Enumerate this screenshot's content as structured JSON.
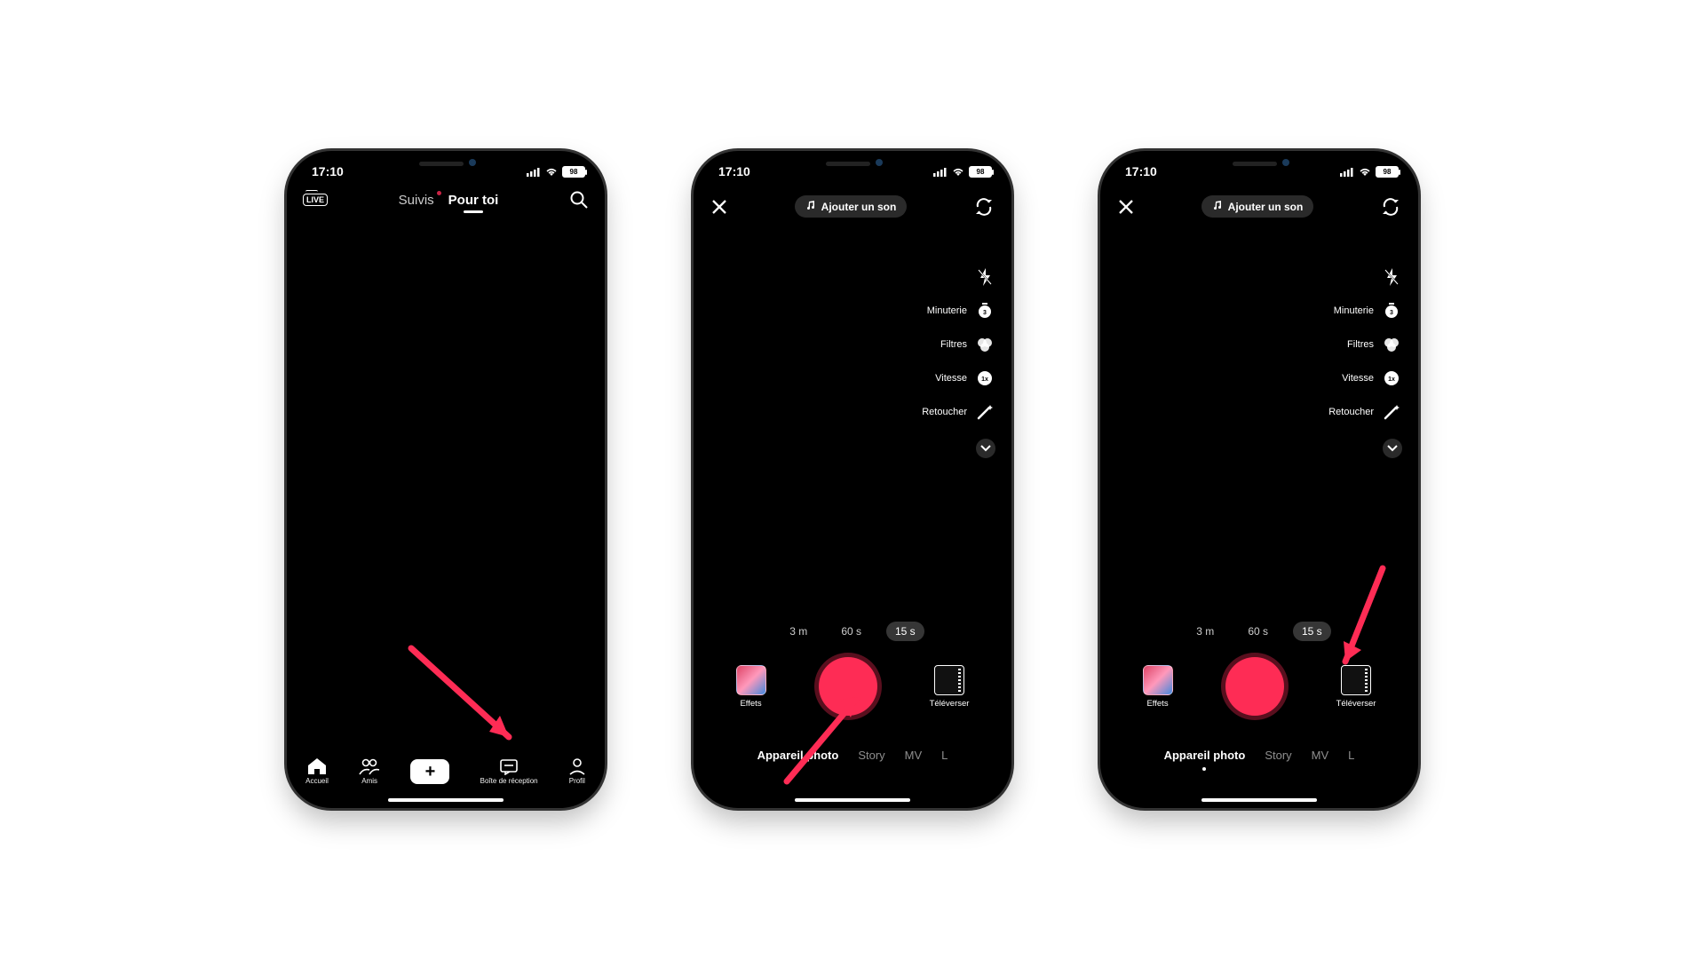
{
  "status": {
    "time": "17:10",
    "battery": "98"
  },
  "feed": {
    "tabs": {
      "following": "Suivis",
      "for_you": "Pour toi"
    },
    "nav": {
      "home": "Accueil",
      "friends": "Amis",
      "inbox": "Boîte de réception",
      "profile": "Profil"
    }
  },
  "camera": {
    "add_sound": "Ajouter un son",
    "tools": {
      "timer": "Minuterie",
      "filters": "Filtres",
      "speed": "Vitesse",
      "beauty": "Retoucher"
    },
    "durations": {
      "d3m": "3 m",
      "d60s": "60 s",
      "d15s": "15 s"
    },
    "effects": "Effets",
    "upload": "Téléverser",
    "modes": {
      "camera": "Appareil photo",
      "story": "Story",
      "mv": "MV",
      "l": "L"
    }
  }
}
